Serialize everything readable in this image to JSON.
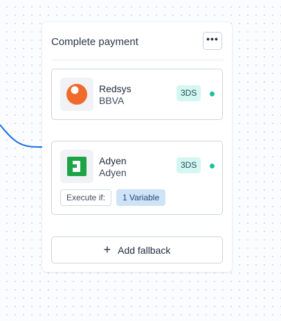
{
  "card": {
    "title": "Complete payment",
    "more_label": "•••"
  },
  "steps": [
    {
      "provider": "Redsys",
      "subtitle": "BBVA",
      "badge": "3DS",
      "logo_icon": "redsys-logo",
      "status_color": "#1fbf9f"
    },
    {
      "provider": "Adyen",
      "subtitle": "Adyen",
      "badge": "3DS",
      "logo_icon": "adyen-logo",
      "status_color": "#1fbf9f",
      "condition": {
        "label": "Execute if:",
        "value": "1 Variable"
      }
    }
  ],
  "add_fallback": {
    "label": "Add fallback",
    "icon": "plus-icon"
  },
  "colors": {
    "connector": "#1e6ee6",
    "badge_bg": "#d5f7f2",
    "variable_chip_bg": "#cfe3f7",
    "redsys_orange": "#f06a2b",
    "adyen_green": "#1ea446"
  }
}
